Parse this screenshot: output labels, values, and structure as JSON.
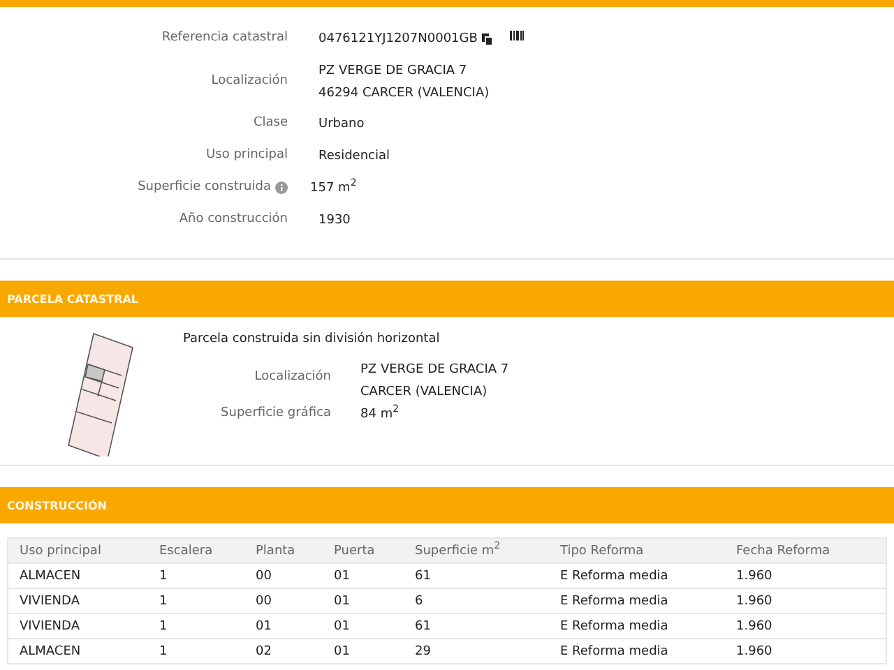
{
  "inmueble": {
    "fields": [
      {
        "label": "Referencia catastral",
        "value": "0476121YJ1207N0001GB",
        "kind": "reference"
      },
      {
        "label": "Localización",
        "lines": [
          "PZ VERGE DE GRACIA 7",
          "46294 CARCER (VALENCIA)"
        ],
        "kind": "multiline"
      },
      {
        "label": "Clase",
        "value": "Urbano",
        "kind": "text"
      },
      {
        "label": "Uso principal",
        "value": "Residencial",
        "kind": "text"
      },
      {
        "label": "Superficie construida",
        "value": "157 m$^{2}$",
        "kind": "info"
      },
      {
        "label": "Año construcción",
        "value": "1930",
        "kind": "text"
      }
    ]
  },
  "parcela": {
    "title": "PARCELA CATASTRAL",
    "description": "Parcela construida sin división horizontal",
    "fields": [
      {
        "label": "Localización",
        "lines": [
          "PZ VERGE DE GRACIA 7",
          "CARCER (VALENCIA)"
        ],
        "kind": "multiline"
      },
      {
        "label": "Superficie gráfica",
        "value": "84 m$^{2}$",
        "kind": "text"
      }
    ]
  },
  "construccion": {
    "title": "CONSTRUCCIÓN",
    "table": {
      "columns": [
        "Uso principal",
        "Escalera",
        "Planta",
        "Puerta",
        "Superficie m$^{2}$",
        "Tipo Reforma",
        "Fecha Reforma"
      ],
      "rows": [
        [
          "ALMACEN",
          "1",
          "00",
          "01",
          "61",
          "E Reforma media",
          "1.960"
        ],
        [
          "VIVIENDA",
          "1",
          "00",
          "01",
          "6",
          "E Reforma media",
          "1.960"
        ],
        [
          "VIVIENDA",
          "1",
          "01",
          "01",
          "61",
          "E Reforma media",
          "1.960"
        ],
        [
          "ALMACEN",
          "1",
          "02",
          "01",
          "29",
          "E Reforma media",
          "1.960"
        ]
      ]
    }
  }
}
